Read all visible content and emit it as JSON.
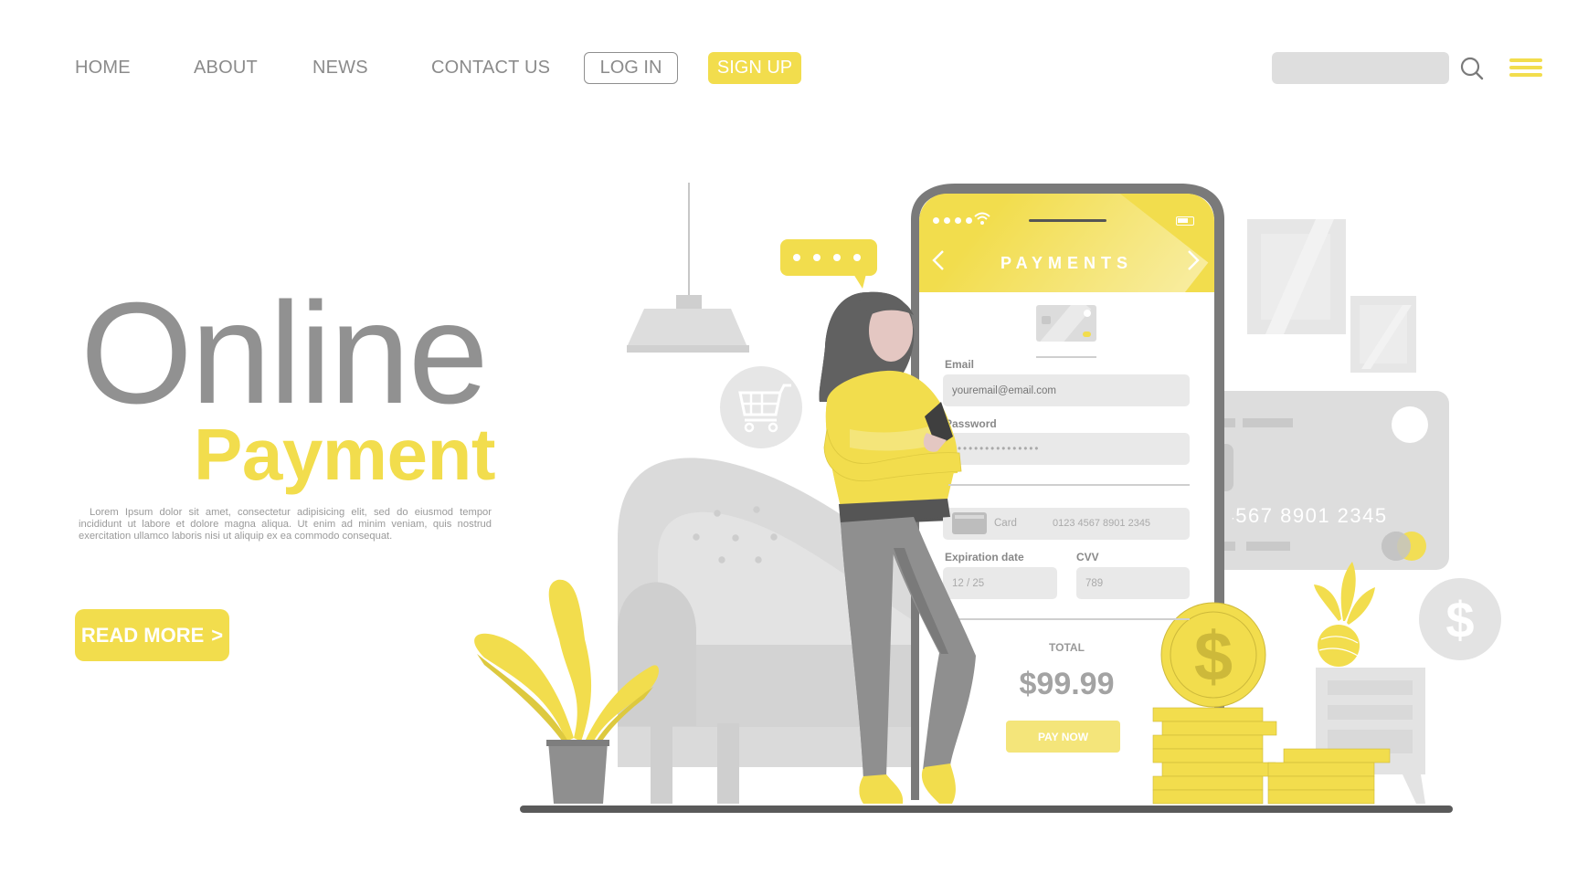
{
  "nav": {
    "links": [
      "HOME",
      "ABOUT",
      "NEWS",
      "CONTACT US"
    ],
    "login_label": "LOG IN",
    "signup_label": "SIGN UP",
    "search_placeholder": "",
    "search_icon": "search-icon",
    "menu_icon": "hamburger-menu-icon"
  },
  "hero": {
    "title": "Online",
    "subtitle": "Payment",
    "description": "Lorem Ipsum dolor sit amet, consectetur adipisicing elit, sed do eiusmod tempor incididunt ut labore et dolore magna aliqua. Ut enim ad minim veniam, quis nostrud exercitation ullamco laboris nisi ut aliquip ex ea commodo consequat.",
    "cta_label": "READ MORE",
    "cta_icon": ">"
  },
  "phone": {
    "header_title": "PAYMENTS",
    "back_icon": "chevron-left-icon",
    "forward_icon": "chevron-right-icon",
    "email_label": "Email",
    "email_placeholder": "youremail@email.com",
    "password_label": "Password",
    "password_value": "••••••••••••••••",
    "card_label": "Card",
    "card_number": "0123 4567 8901 2345",
    "expiration_label": "Expiration date",
    "expiration_value": "12 / 25",
    "cvv_label": "CVV",
    "cvv_value": "789",
    "total_label": "TOTAL",
    "total_value": "$99.99",
    "pay_label": "PAY NOW"
  },
  "illustration": {
    "chat_bubble_dots": 4,
    "background_card_number": "0123 4567 8901 2345",
    "coin_symbol": "$",
    "dollar_badge_symbol": "$"
  },
  "colors": {
    "accent": "#f2dd4d",
    "text_gray": "#8b8b8b",
    "title_gray": "#919191",
    "light_gray": "#dedede",
    "dark_gray": "#5a5a5a"
  }
}
